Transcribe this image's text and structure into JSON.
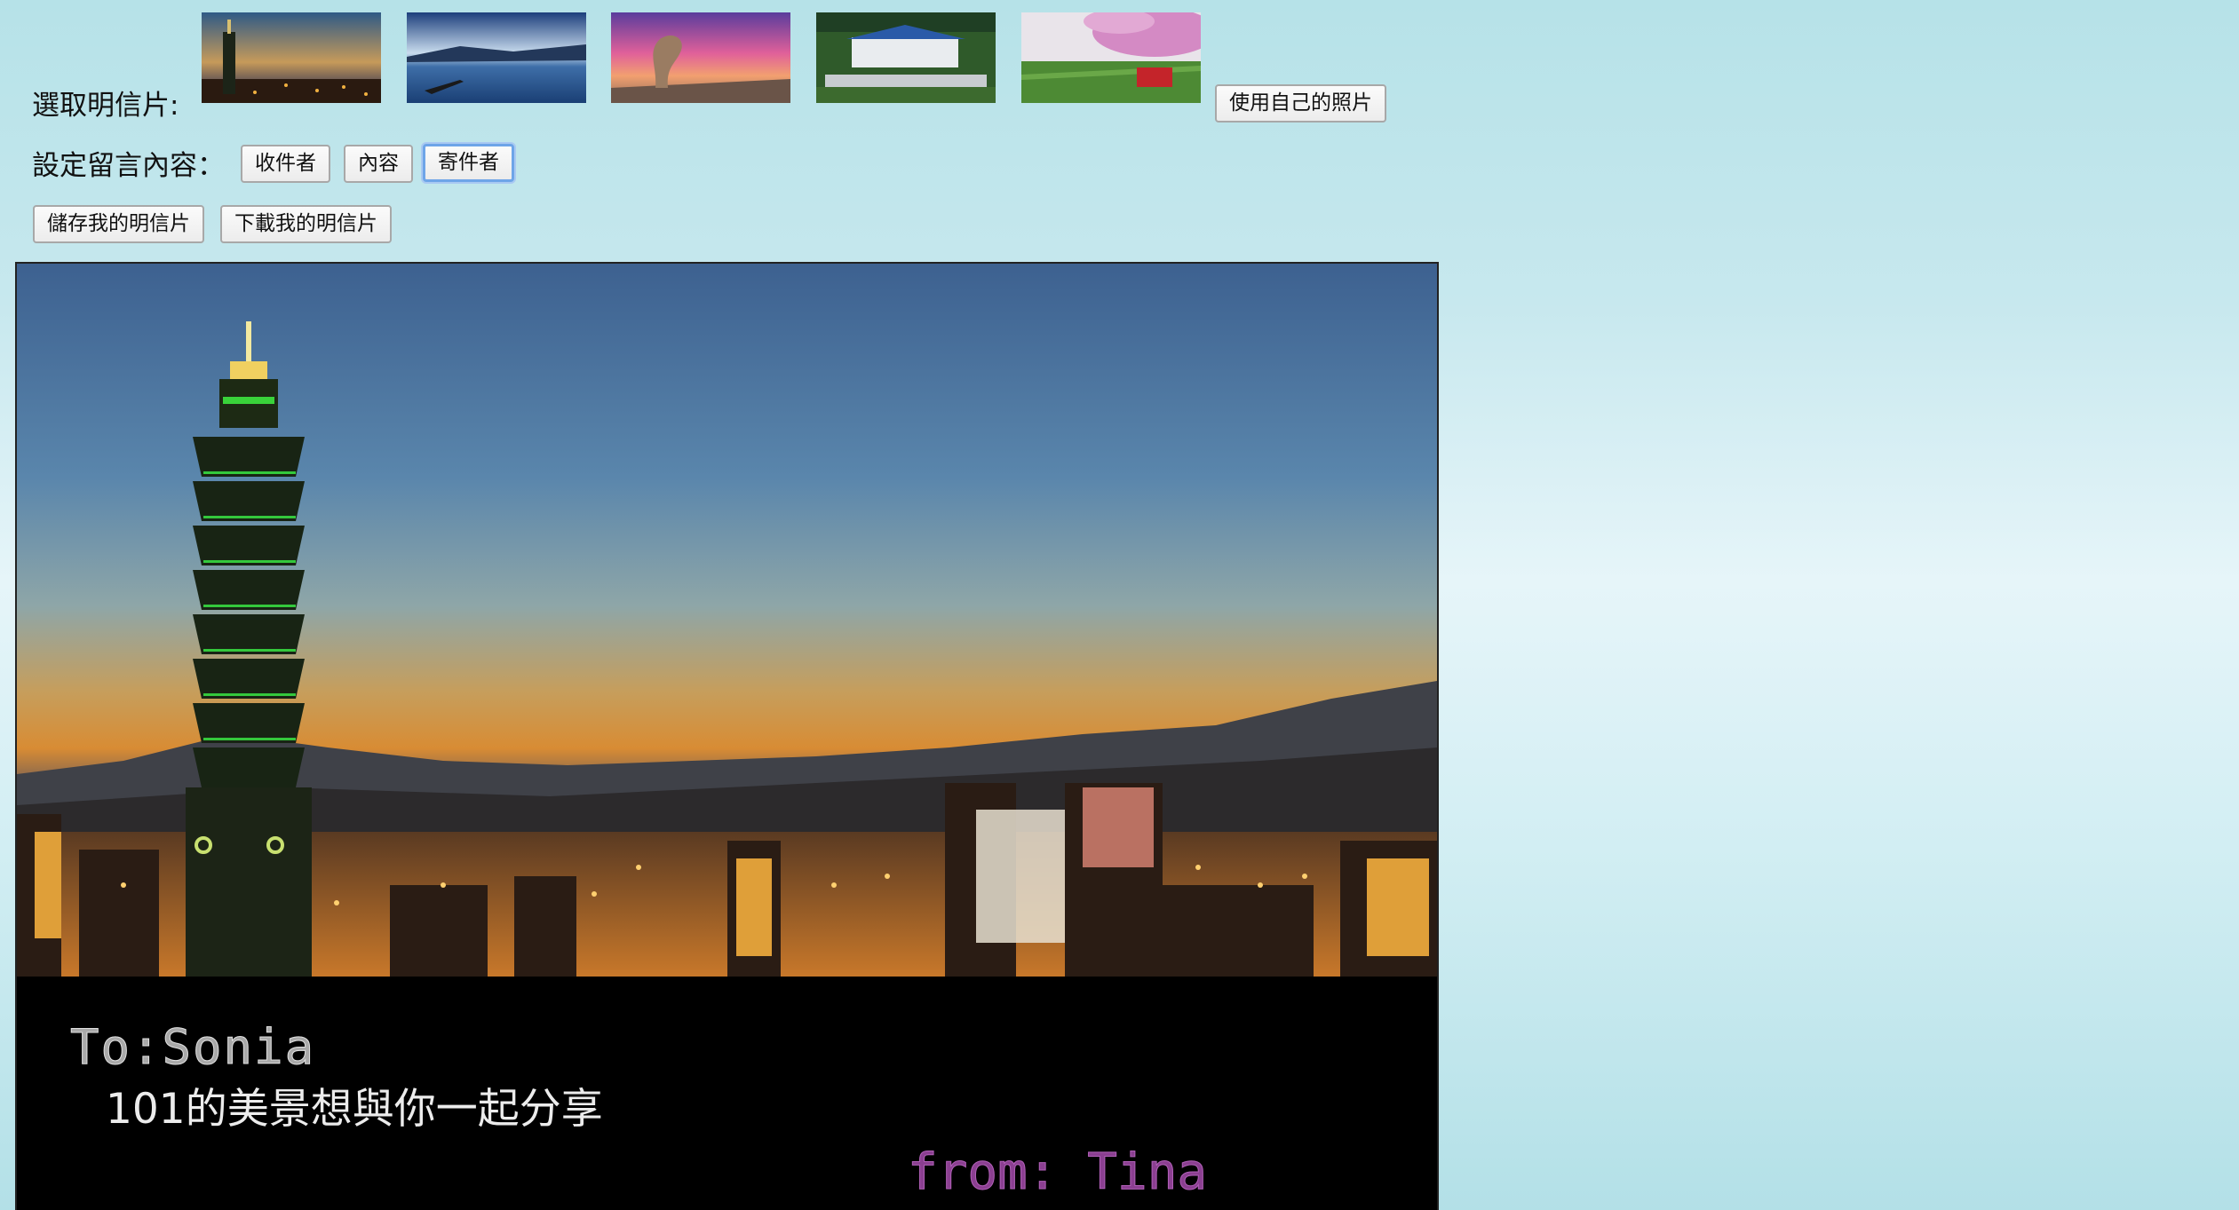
{
  "select_row": {
    "label": "選取明信片:",
    "thumbnails": [
      {
        "name": "thumb-taipei-101",
        "icon": "taipei-101-skyline"
      },
      {
        "name": "thumb-sun-moon-lake",
        "icon": "lake-boat-sunset"
      },
      {
        "name": "thumb-queens-head-rock",
        "icon": "rock-formation-sunset"
      },
      {
        "name": "thumb-palace",
        "icon": "palace-garden"
      },
      {
        "name": "thumb-alishan-train",
        "icon": "cherry-blossom-train"
      }
    ],
    "own_photo_button": "使用自己的照片"
  },
  "message_row": {
    "label": "設定留言內容：",
    "buttons": {
      "recipient": "收件者",
      "content": "內容",
      "sender": "寄件者"
    }
  },
  "actions": {
    "save": "儲存我的明信片",
    "download": "下載我的明信片"
  },
  "postcard": {
    "to_text": "To:Sonia",
    "content_text": "101的美景想與你一起分享",
    "from_text": "from: Tina",
    "to_color": "#a9a9a9",
    "content_color": "#ececec",
    "from_color": "#8b3f91"
  },
  "colors": {
    "page_bg_top": "#b6e2e8",
    "page_bg_mid": "#e6f5f9",
    "focus_ring": "#6ea5e8"
  }
}
